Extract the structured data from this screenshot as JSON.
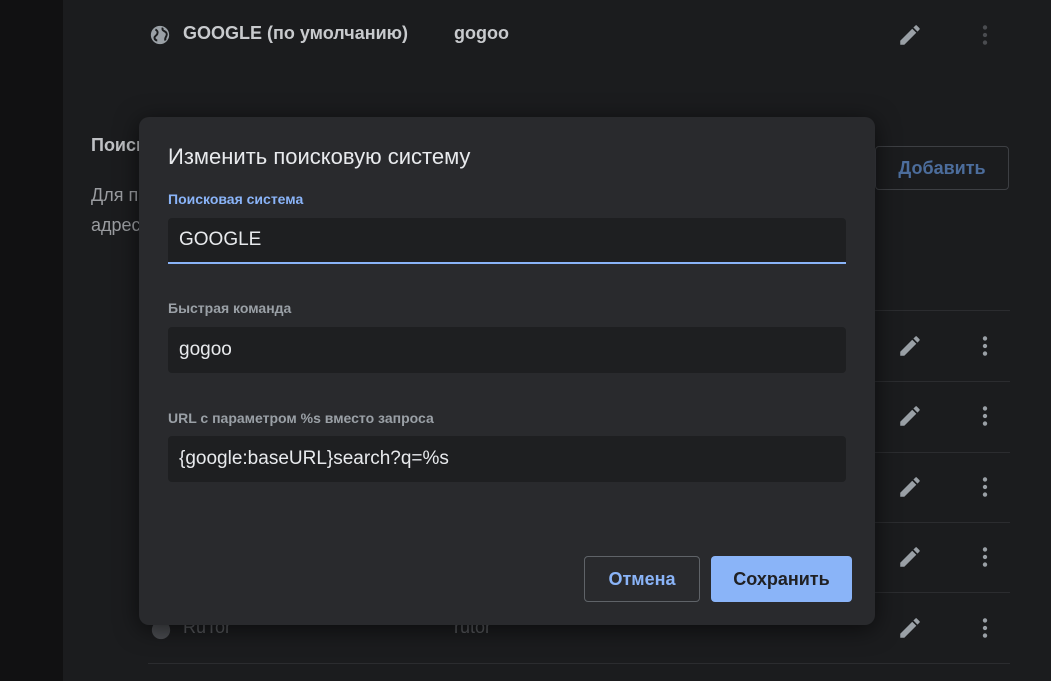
{
  "background_list": {
    "default_engine": {
      "name": "GOOGLE (по умолчанию)",
      "keyword": "gogoo"
    },
    "section_title": "Поиск",
    "section_desc_line1": "Для п",
    "section_desc_line2": "адрес",
    "add_button": "Добавить",
    "last_visible_engine": {
      "name": "RuTor",
      "keyword": "rutor"
    },
    "icons": [
      "globe-icon",
      "pencil-icon",
      "more-vert-icon"
    ]
  },
  "dialog": {
    "title": "Изменить поисковую систему",
    "fields": [
      {
        "label": "Поисковая система",
        "value": "GOOGLE"
      },
      {
        "label": "Быстрая команда",
        "value": "gogoo"
      },
      {
        "label": "URL с параметром %s вместо запроса",
        "value": "{google:baseURL}search?q=%s"
      }
    ],
    "cancel_label": "Отмена",
    "save_label": "Сохранить"
  },
  "colors": {
    "accent": "#8ab4f8",
    "dialog_bg": "#292a2d",
    "page_bg": "#1b1c1e"
  }
}
